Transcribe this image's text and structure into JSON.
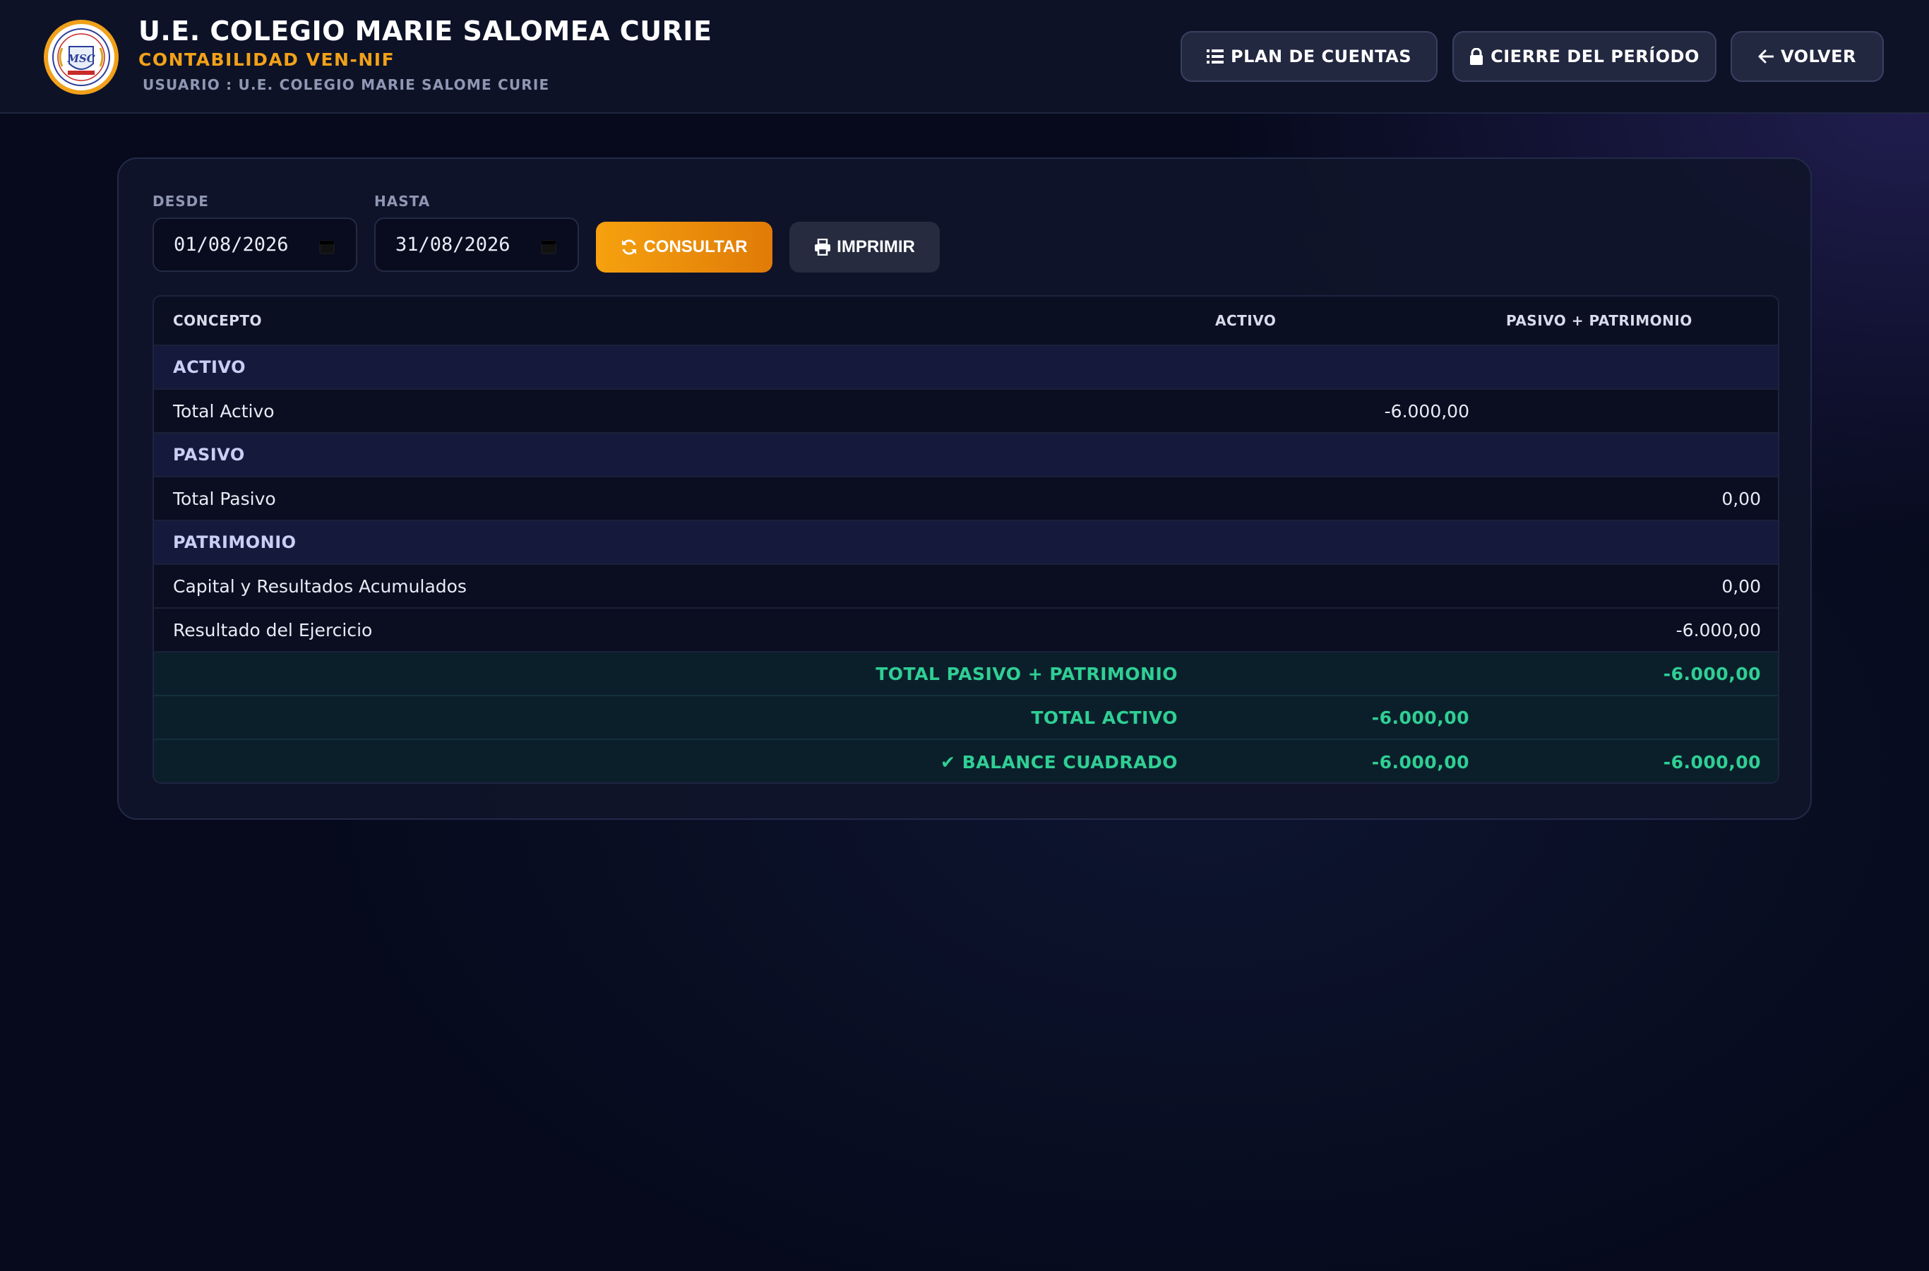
{
  "header": {
    "title": "U.E. COLEGIO MARIE SALOMEA CURIE",
    "subtitle": "CONTABILIDAD VEN-NIF",
    "user_icon": "",
    "user_line": "USUARIO : U.E. COLEGIO MARIE SALOME CURIE",
    "logo_text": "MSC",
    "buttons": {
      "plan": "PLAN DE CUENTAS",
      "cierre": "CIERRE DEL PERÍODO",
      "volver": "VOLVER"
    }
  },
  "filters": {
    "desde_label": "DESDE",
    "desde_value": "01/08/2026",
    "hasta_label": "HASTA",
    "hasta_value": "31/08/2026",
    "consultar": "CONSULTAR",
    "imprimir": "IMPRIMIR"
  },
  "table": {
    "columns": [
      "CONCEPTO",
      "ACTIVO",
      "PASIVO + PATRIMONIO"
    ],
    "rows": [
      {
        "type": "section",
        "concept": "ACTIVO",
        "activo": "",
        "pp": ""
      },
      {
        "type": "item",
        "concept": "Total Activo",
        "activo": "-6.000,00",
        "pp": ""
      },
      {
        "type": "section",
        "concept": "PASIVO",
        "activo": "",
        "pp": ""
      },
      {
        "type": "item",
        "concept": "Total Pasivo",
        "activo": "",
        "pp": "0,00"
      },
      {
        "type": "section",
        "concept": "PATRIMONIO",
        "activo": "",
        "pp": ""
      },
      {
        "type": "item",
        "concept": "Capital y Resultados Acumulados",
        "activo": "",
        "pp": "0,00"
      },
      {
        "type": "item",
        "concept": "Resultado del Ejercicio",
        "activo": "",
        "pp": "-6.000,00"
      },
      {
        "type": "total",
        "concept": "TOTAL PASIVO + PATRIMONIO",
        "activo": "",
        "pp": "-6.000,00"
      },
      {
        "type": "total",
        "concept": "TOTAL ACTIVO",
        "activo": "-6.000,00",
        "pp": ""
      },
      {
        "type": "total",
        "concept": "✔ BALANCE CUADRADO",
        "activo": "-6.000,00",
        "pp": "-6.000,00"
      }
    ]
  },
  "colors": {
    "accent": "#f2a118",
    "success": "#2fcf94",
    "section_bg": "#151a3d",
    "header_bg": "#0d1227"
  },
  "icons": {
    "plan": "list-icon",
    "cierre": "lock-icon",
    "volver": "arrow-left-icon",
    "consultar": "refresh-icon",
    "imprimir": "printer-icon",
    "date": "calendar-icon",
    "user": "user-icon"
  }
}
